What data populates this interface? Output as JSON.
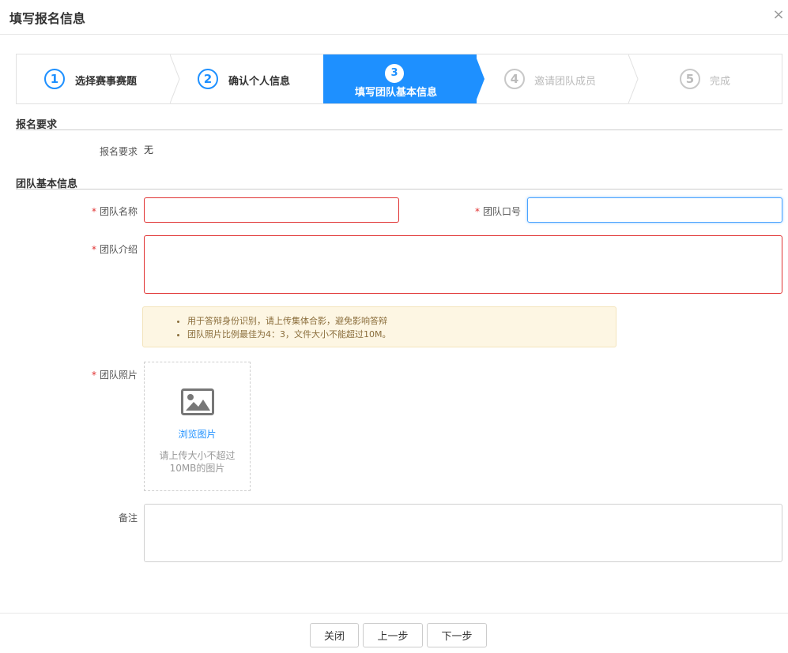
{
  "dialog": {
    "title": "填写报名信息",
    "close_symbol": "×"
  },
  "steps": [
    {
      "number": "1",
      "label": "选择赛事赛题",
      "state": "done"
    },
    {
      "number": "2",
      "label": "确认个人信息",
      "state": "done"
    },
    {
      "number": "3",
      "label": "填写团队基本信息",
      "state": "active"
    },
    {
      "number": "4",
      "label": "邀请团队成员",
      "state": "pending"
    },
    {
      "number": "5",
      "label": "完成",
      "state": "pending"
    }
  ],
  "requirements": {
    "section_title": "报名要求",
    "label": "报名要求",
    "value": "无"
  },
  "team": {
    "section_title": "团队基本信息",
    "name_label": "团队名称",
    "name_value": "",
    "slogan_label": "团队口号",
    "slogan_value": "",
    "intro_label": "团队介绍",
    "intro_value": "",
    "required_mark": "*",
    "tips": [
      "用于答辩身份识别，请上传集体合影，避免影响答辩",
      "团队照片比例最佳为4：3，文件大小不能超过10M。"
    ],
    "photo_label": "团队照片",
    "photo_browse": "浏览图片",
    "photo_hint": "请上传大小不超过10MB的图片",
    "remark_label": "备注",
    "remark_value": ""
  },
  "footer": {
    "close_label": "关闭",
    "prev_label": "上一步",
    "next_label": "下一步"
  },
  "colors": {
    "accent": "#1e90ff",
    "required": "#e03131",
    "tip_bg": "#fdf6e3"
  }
}
